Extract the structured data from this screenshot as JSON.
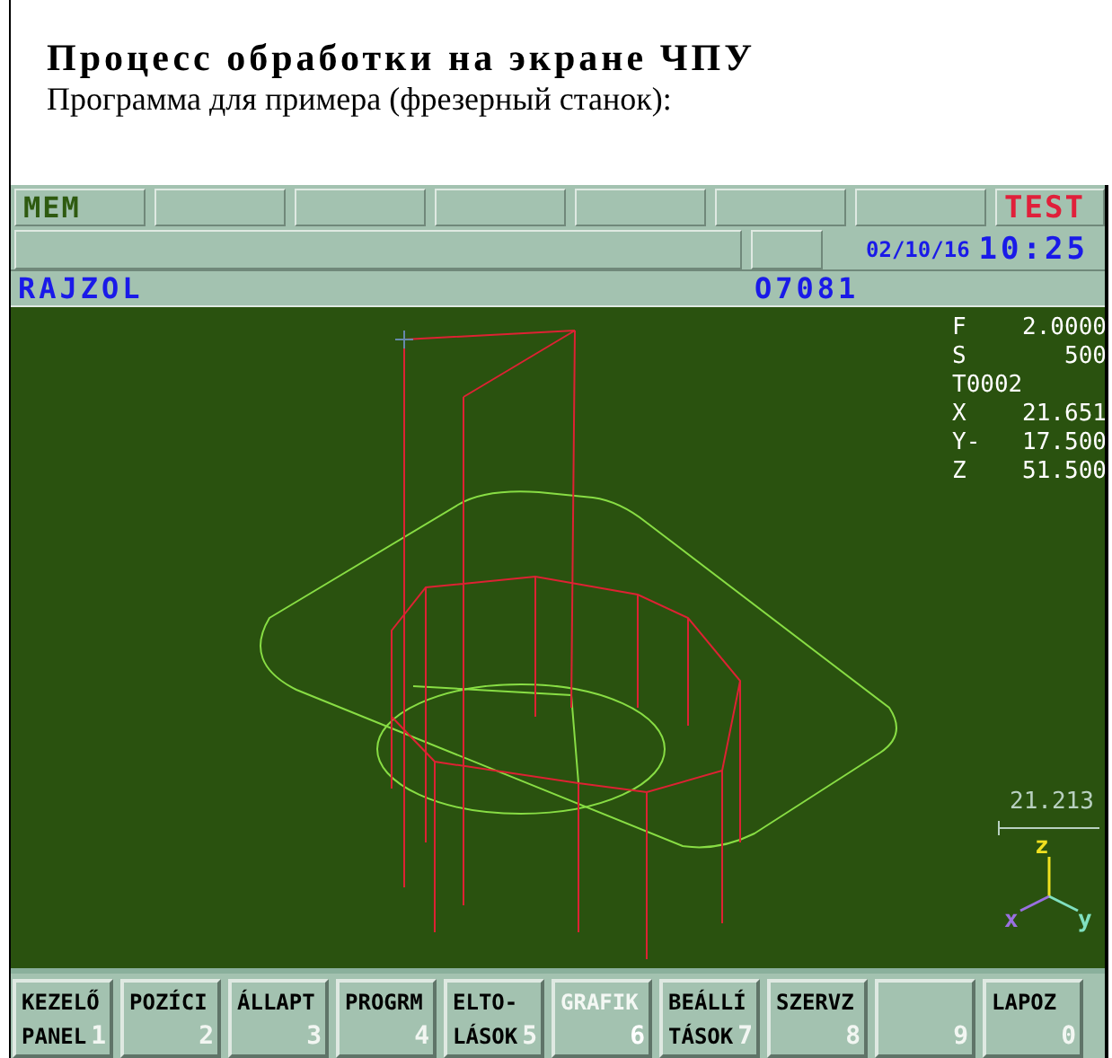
{
  "heading": {
    "title": "Процесс обработки на экране ЧПУ",
    "subtitle": "Программа для примера (фрезерный станок):"
  },
  "status_row": {
    "mode": "MEM",
    "alarm": "TEST"
  },
  "info_row": {
    "date": "02/10/16",
    "time": "10:25"
  },
  "title_row": {
    "screen": "RAJZOL",
    "program": "O7081"
  },
  "readouts": [
    {
      "label": "F",
      "value": "2.0000"
    },
    {
      "label": "S",
      "value": "500"
    },
    {
      "label": "T0002"
    },
    {
      "label": "X",
      "value": "21.651"
    },
    {
      "label": "Y-",
      "value": "17.500"
    },
    {
      "label": "Z",
      "value": "51.500"
    }
  ],
  "scale": "21.213",
  "axes": [
    {
      "label": "z",
      "color": "#f0e020"
    },
    {
      "label": "x",
      "color": "#9a70e0"
    },
    {
      "label": "y",
      "color": "#80e0c0"
    }
  ],
  "softkeys": [
    {
      "lines": [
        "KEZELŐ",
        "PANEL"
      ],
      "number": "1",
      "selected": false
    },
    {
      "lines": [
        "POZÍCI"
      ],
      "number": "2",
      "selected": false
    },
    {
      "lines": [
        "ÁLLAPT"
      ],
      "number": "3",
      "selected": false
    },
    {
      "lines": [
        "PROGRM"
      ],
      "number": "4",
      "selected": false
    },
    {
      "lines": [
        "ELTO-",
        "LÁSOK"
      ],
      "number": "5",
      "selected": false
    },
    {
      "lines": [
        "GRAFIK"
      ],
      "number": "6",
      "selected": true
    },
    {
      "lines": [
        "BEÁLLÍ",
        "TÁSOK"
      ],
      "number": "7",
      "selected": false
    },
    {
      "lines": [
        "SZERVZ"
      ],
      "number": "8",
      "selected": false
    },
    {
      "number": "9",
      "selected": false
    },
    {
      "lines": [
        "LAPOZ"
      ],
      "number": "0",
      "selected": false
    }
  ]
}
